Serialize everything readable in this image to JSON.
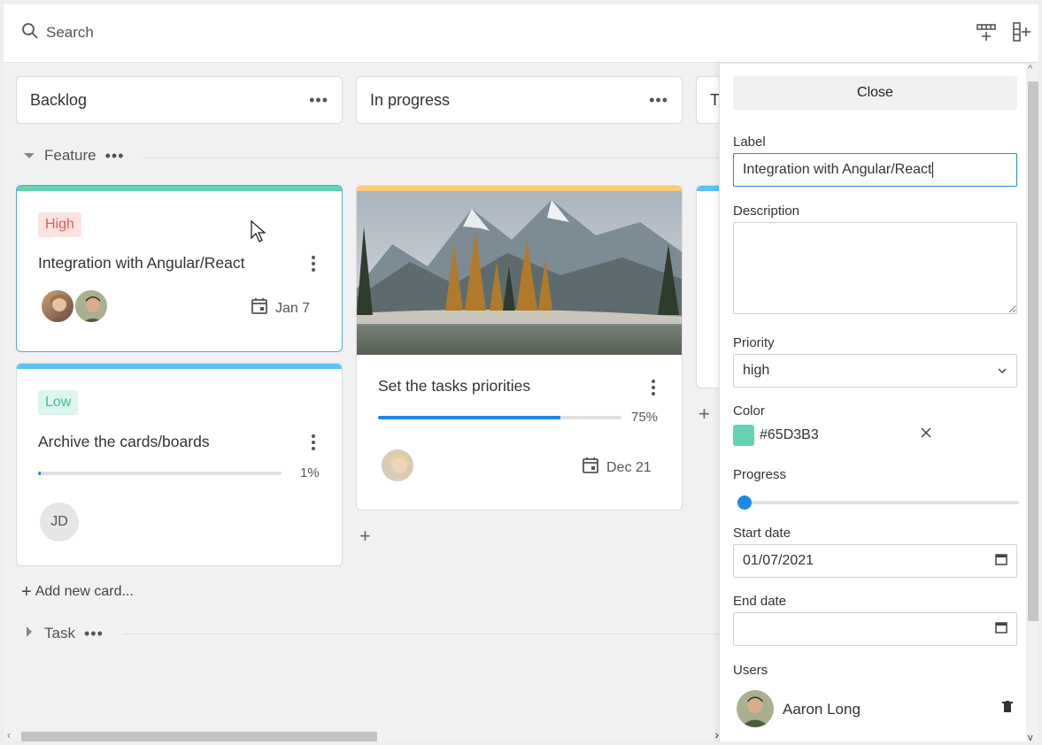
{
  "toolbar": {
    "search_placeholder": "Search",
    "icons": [
      "add-row-icon",
      "add-column-icon"
    ]
  },
  "columns": [
    {
      "label": "Backlog"
    },
    {
      "label": "In progress"
    },
    {
      "label": "T"
    }
  ],
  "groups": [
    {
      "label": "Feature",
      "expanded": true
    },
    {
      "label": "Task",
      "expanded": false
    }
  ],
  "cards": {
    "integration": {
      "badge": "High",
      "title": "Integration with Angular/React",
      "date": "Jan 7",
      "color": "#65D3B3"
    },
    "archive": {
      "badge": "Low",
      "title": "Archive the cards/boards",
      "progress": 1,
      "progress_label": "1%",
      "avatar_initials": "JD",
      "color": "#58C3FE"
    },
    "priorities": {
      "title": "Set the tasks priorities",
      "progress": 75,
      "progress_label": "75%",
      "date": "Dec 21",
      "color": "#FFC975"
    }
  },
  "add_card_label": "Add new card...",
  "panel": {
    "close_label": "Close",
    "label_label": "Label",
    "label_value": "Integration with Angular/React",
    "description_label": "Description",
    "description_value": "",
    "priority_label": "Priority",
    "priority_value": "high",
    "color_label": "Color",
    "color_value": "#65D3B3",
    "progress_label": "Progress",
    "progress_value": 0,
    "start_date_label": "Start date",
    "start_date_value": "01/07/2021",
    "end_date_label": "End date",
    "end_date_value": "",
    "users_label": "Users",
    "users": [
      {
        "name": "Aaron Long"
      }
    ]
  },
  "colors": {
    "accent": "#1e88e5",
    "high_bg": "#fde2e2",
    "high_fg": "#e65a5a",
    "low_bg": "#dcf5ee",
    "low_fg": "#3fbf9b"
  }
}
